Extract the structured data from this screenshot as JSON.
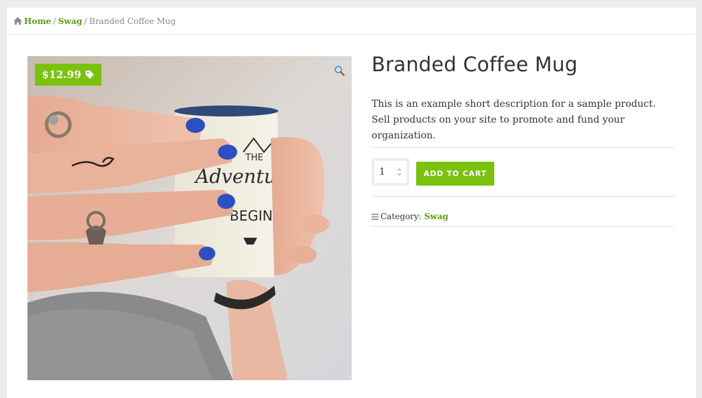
{
  "breadcrumb": {
    "home": "Home",
    "parent": "Swag",
    "current": "Branded Coffee Mug",
    "separator": "/"
  },
  "product": {
    "title": "Branded Coffee Mug",
    "price": "$12.99",
    "short_description": "This is an example short description for a sample product. Sell products on your site to promote and fund your organization.",
    "quantity": "1",
    "add_to_cart_label": "ADD TO CART",
    "category_label": "Category:",
    "category_value": "Swag"
  },
  "image": {
    "mug_text_line1": "THE",
    "mug_text_line2": "Adventure",
    "mug_text_line3": "BEGINS"
  },
  "icons": {
    "home": "home-icon",
    "tag": "tag-icon",
    "zoom": "magnifier-icon",
    "category": "list-icon",
    "stepper": "stepper-arrows-icon"
  },
  "colors": {
    "accent": "#7bc20f",
    "link": "#5c9c1a",
    "text": "#333333",
    "muted": "#8a8a8a"
  }
}
